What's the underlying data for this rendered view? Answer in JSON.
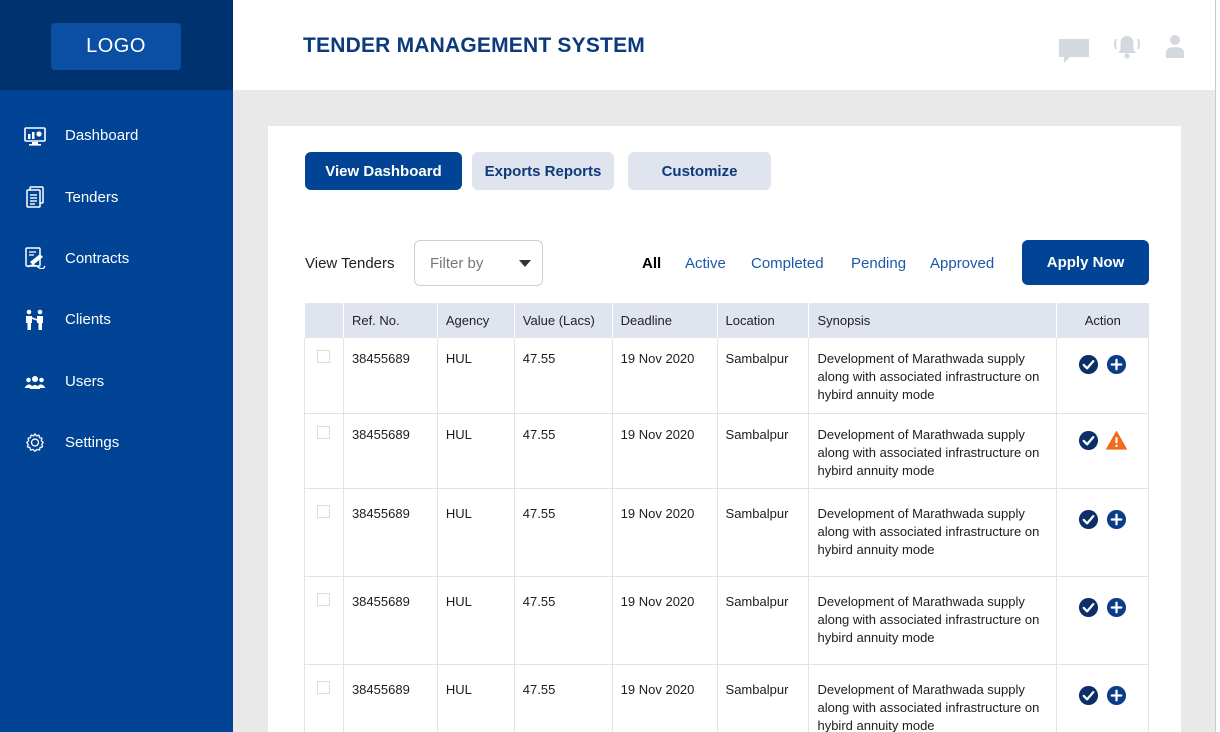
{
  "brand": {
    "logo_text": "LOGO",
    "app_title": "TENDER MANAGEMENT SYSTEM"
  },
  "sidebar": {
    "items": [
      {
        "label": "Dashboard",
        "icon": "dashboard-icon"
      },
      {
        "label": "Tenders",
        "icon": "tenders-icon"
      },
      {
        "label": "Contracts",
        "icon": "contracts-icon"
      },
      {
        "label": "Clients",
        "icon": "clients-icon"
      },
      {
        "label": "Users",
        "icon": "users-icon"
      },
      {
        "label": "Settings",
        "icon": "gear-icon"
      }
    ]
  },
  "header": {
    "icons": [
      "chat-icon",
      "bell-icon",
      "user-icon"
    ]
  },
  "toolbar": {
    "view_dashboard": "View Dashboard",
    "exports_reports": "Exports Reports",
    "customize": "Customize"
  },
  "filters": {
    "view_label": "View Tenders",
    "filter_placeholder": "Filter by",
    "tabs": [
      "All",
      "Active",
      "Completed",
      "Pending",
      "Approved"
    ],
    "active_tab": "All",
    "apply_label": "Apply Now"
  },
  "table": {
    "columns": [
      "Ref. No.",
      "Agency",
      "Value (Lacs)",
      "Deadline",
      "Location",
      "Synopsis",
      "Action"
    ],
    "rows": [
      {
        "ref": "38455689",
        "agency": "HUL",
        "value": "47.55",
        "deadline": "19 Nov 2020",
        "location": "Sambalpur",
        "synopsis": "Development of Marathwada supply along with associated infrastructure on hybird annuity mode",
        "actions": [
          "check-circle-icon",
          "plus-circle-icon"
        ]
      },
      {
        "ref": "38455689",
        "agency": "HUL",
        "value": "47.55",
        "deadline": "19 Nov 2020",
        "location": "Sambalpur",
        "synopsis": "Development of Marathwada supply along with associated infrastructure on hybird annuity mode",
        "actions": [
          "check-circle-icon",
          "warning-icon"
        ]
      },
      {
        "ref": "38455689",
        "agency": "HUL",
        "value": "47.55",
        "deadline": "19 Nov 2020",
        "location": "Sambalpur",
        "synopsis": "Development of Marathwada supply along with associated infrastructure on hybird annuity mode",
        "actions": [
          "check-circle-icon",
          "plus-circle-icon"
        ]
      },
      {
        "ref": "38455689",
        "agency": "HUL",
        "value": "47.55",
        "deadline": "19 Nov 2020",
        "location": "Sambalpur",
        "synopsis": "Development of Marathwada supply along with associated infrastructure on hybird annuity mode",
        "actions": [
          "check-circle-icon",
          "plus-circle-icon"
        ]
      },
      {
        "ref": "38455689",
        "agency": "HUL",
        "value": "47.55",
        "deadline": "19 Nov 2020",
        "location": "Sambalpur",
        "synopsis": "Development of Marathwada supply along with associated infrastructure on hybird annuity mode",
        "actions": [
          "check-circle-icon",
          "plus-circle-icon"
        ]
      }
    ]
  },
  "colors": {
    "sidebar": "#014395",
    "logo_bar": "#003270",
    "primary": "#014395",
    "title": "#0d3a7a",
    "tab_link": "#1b59a8",
    "warning": "#f26b1d"
  }
}
